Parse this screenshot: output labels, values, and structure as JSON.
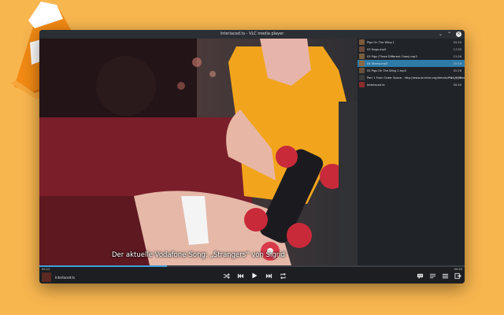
{
  "window": {
    "title": "Interlaced.ts - VLC media player"
  },
  "video": {
    "subtitle": "Der aktuelle Vodafone-Song: „Strangers“ von Sigrid"
  },
  "playlist": {
    "items": [
      {
        "title": "Pigs On The Wing 1",
        "duration": "01:25",
        "color": "#7a5a3a"
      },
      {
        "title": "03 Dogs.mp3",
        "duration": "17:05",
        "color": "#6b4a3a"
      },
      {
        "title": "03 Pigs (Three Different Ones).mp3",
        "duration": "11:26",
        "color": "#7a5f3f"
      },
      {
        "title": "04 Sheep.mp3",
        "duration": "10:18",
        "color": "#8a6a44",
        "selected": true
      },
      {
        "title": "05 Pigs On The Wing 2.mp3",
        "duration": "01:26",
        "color": "#6a5038"
      },
      {
        "title": "Part 1 From Outer Space - http://www.archive.org/details/Plan_9_From_Outer_Space",
        "duration": "1:19:08",
        "color": "#3a3a3a"
      },
      {
        "title": "Interlaced.ts",
        "duration": "00:40",
        "color": "#8a2e2a"
      }
    ]
  },
  "player": {
    "time_elapsed": "00:12",
    "time_total": "00:40",
    "progress": 0.3,
    "now_playing": "Interlaced.ts",
    "accent": "#3f9fd9"
  },
  "icons": {
    "shuffle": "shuffle-icon",
    "previous": "previous-icon",
    "play": "play-icon",
    "next": "next-icon",
    "repeat": "repeat-icon",
    "subtitles": "subtitles-icon",
    "playlist": "playlist-icon",
    "menu": "menu-icon",
    "fullscreen": "fullscreen-icon"
  }
}
